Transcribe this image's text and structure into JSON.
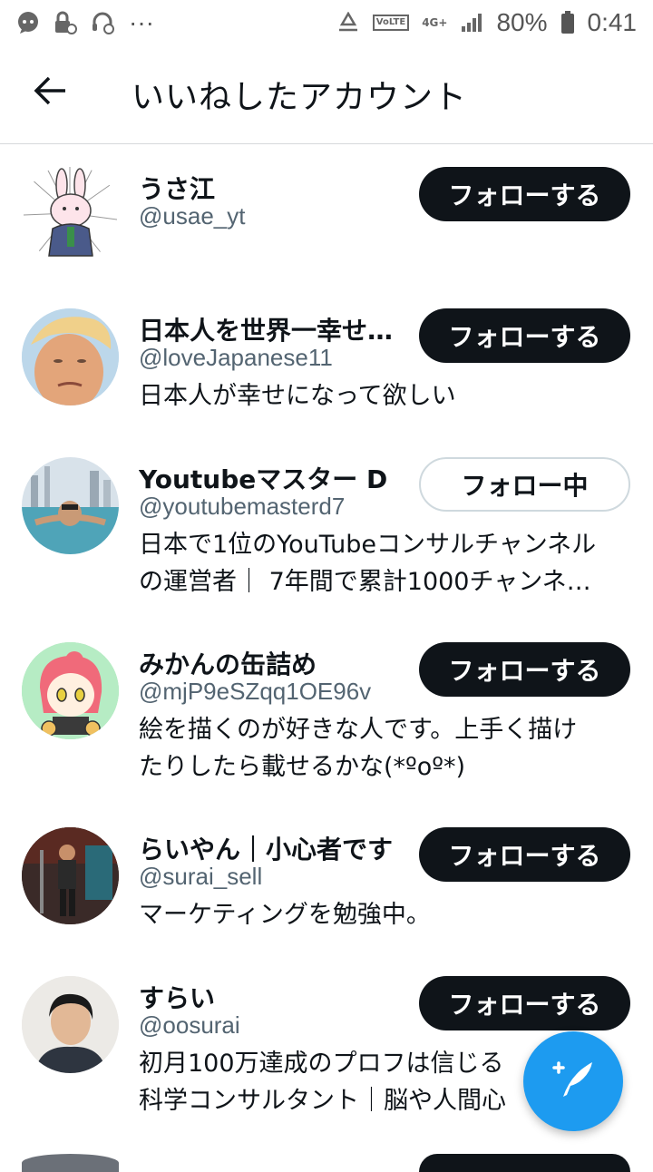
{
  "status_bar": {
    "battery": "80%",
    "time": "0:41",
    "volte": "VoLTE",
    "network": "4G+",
    "more": "···"
  },
  "header": {
    "title": "いいねしたアカウント"
  },
  "accounts": [
    {
      "name": "うさ江",
      "handle": "@usae_yt",
      "bio": [],
      "button": "フォローする"
    },
    {
      "name": "日本人を世界一幸せ…",
      "handle": "@loveJapanese11",
      "bio": [
        "日本人が幸せになって欲しい"
      ],
      "button": "フォローする"
    },
    {
      "name": "Youtubeマスター D",
      "handle": "@youtubemasterd7",
      "bio": [
        "日本で1位のYouTubeコンサルチャンネル",
        "の運営者｜ 7年間で累計1000チャンネ…"
      ],
      "button": "フォロー中"
    },
    {
      "name": "みかんの缶詰め",
      "handle": "@mjP9eSZqq1OE96v",
      "bio": [
        "絵を描くのが好きな人です。上手く描け",
        "たりしたら載せるかな(*ºoº*)"
      ],
      "button": "フォローする"
    },
    {
      "name": "らいやん｜小心者です",
      "handle": "@surai_sell",
      "bio": [
        "マーケティングを勉強中。"
      ],
      "button": "フォローする"
    },
    {
      "name": "すらい",
      "handle": "@oosurai",
      "bio": [
        "初月100万達成のプロフは信じる",
        "科学コンサルタント｜脳や人間心"
      ],
      "button": "フォローする"
    }
  ],
  "colors": {
    "accent": "#1d9bf0",
    "button_dark": "#0f1419",
    "secondary_text": "#536471"
  },
  "icons": {
    "back": "arrow-left-icon",
    "fab": "compose-tweet-icon"
  }
}
